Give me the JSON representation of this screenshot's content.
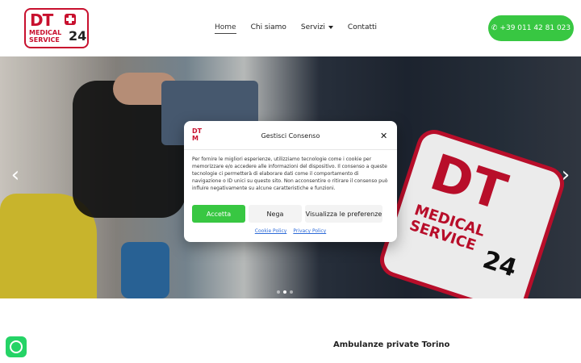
{
  "header": {
    "nav": [
      {
        "label": "Home",
        "active": true
      },
      {
        "label": "Chi siamo"
      },
      {
        "label": "Servizi",
        "has_dropdown": true
      },
      {
        "label": "Contatti"
      }
    ],
    "phone_button_label": "+39 011 42 81 023"
  },
  "hero": {
    "prev_icon": "chevron-left-icon",
    "next_icon": "chevron-right-icon",
    "dots_total": 3,
    "dots_active": 2
  },
  "consent_modal": {
    "title": "Gestisci Consenso",
    "text": "Per fornire le migliori esperienze, utilizziamo tecnologie come i cookie per memorizzare e/o accedere alle informazioni del dispositivo. Il consenso a queste tecnologie ci permetterà di elaborare dati come il comportamento di navigazione o ID unici su questo sito. Non acconsentire o ritirare il consenso può influire negativamente su alcune caratteristiche e funzioni.",
    "buttons": {
      "accept": "Accetta",
      "deny": "Nega",
      "preferences": "Visualizza le preferenze"
    },
    "links": {
      "cookie_policy": "Cookie Policy",
      "privacy_policy": "Privacy Policy"
    }
  },
  "section": {
    "title": "Ambulanze private Torino"
  },
  "colors": {
    "brand_red": "#c8102e",
    "cta_green": "#38c742",
    "whatsapp_green": "#25d366",
    "link_blue": "#2e6bd8"
  }
}
